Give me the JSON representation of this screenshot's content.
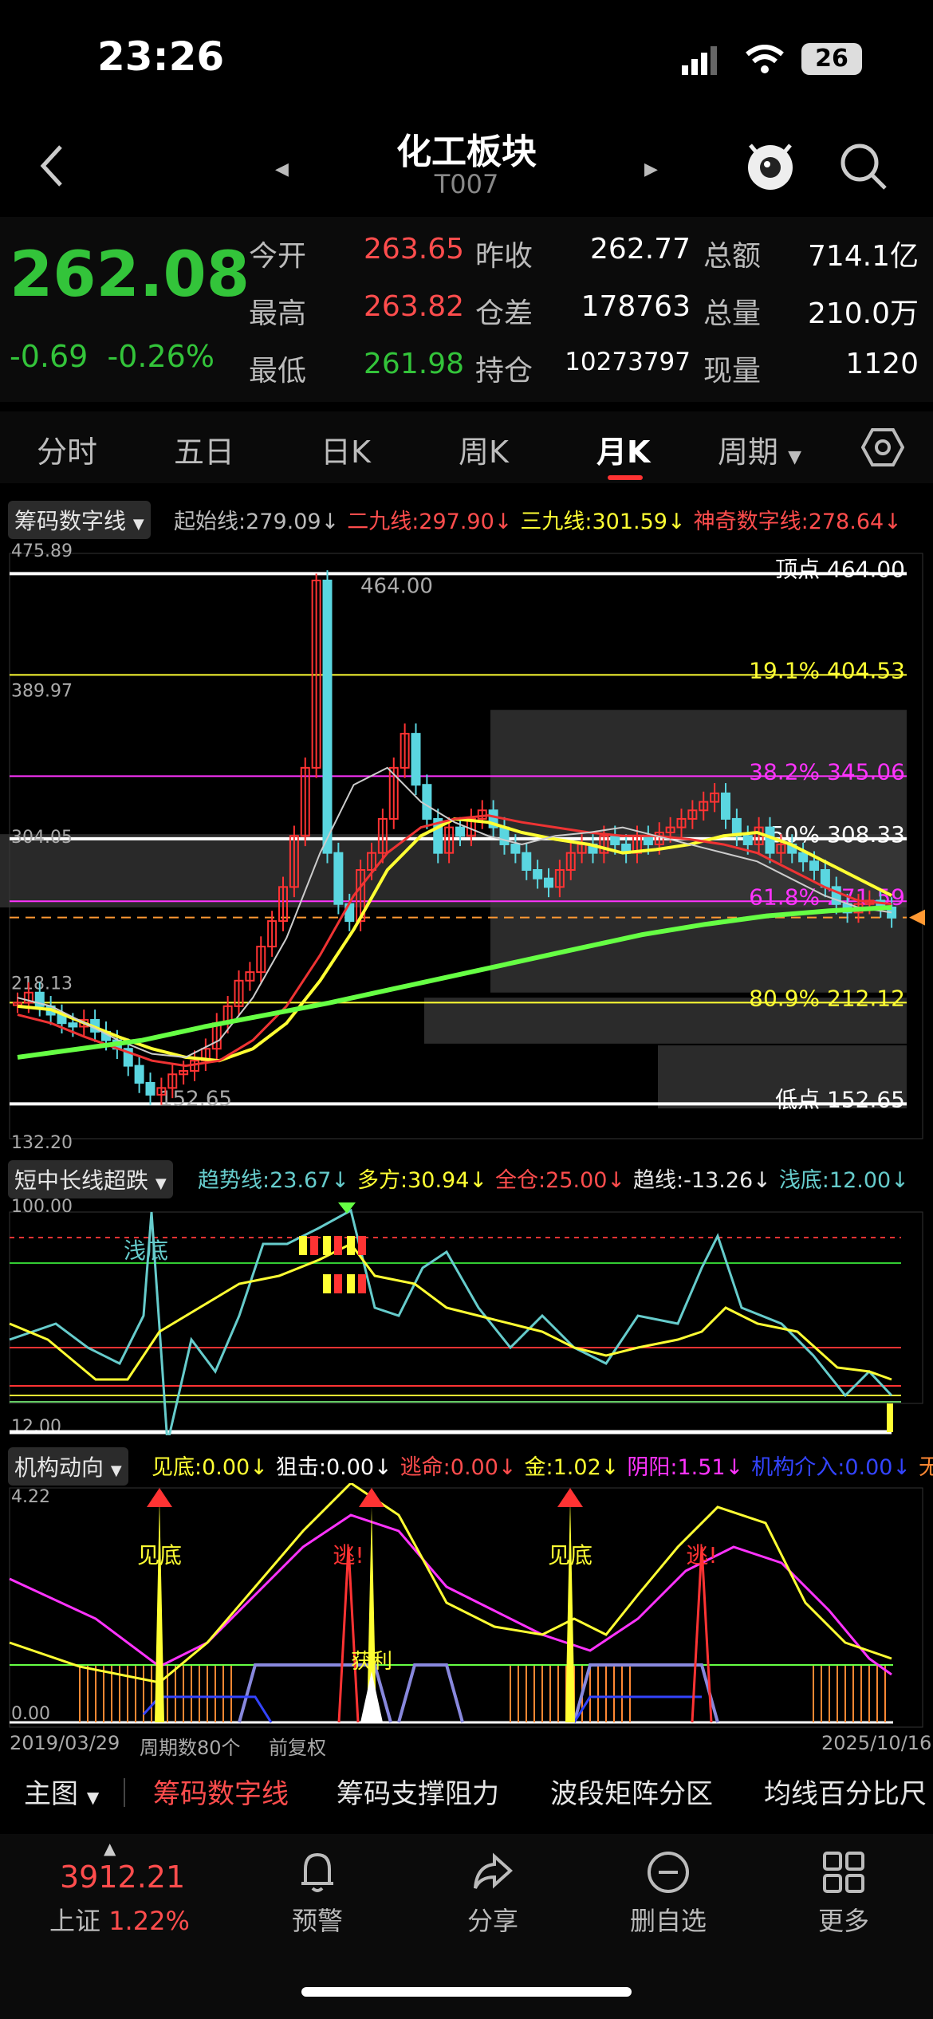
{
  "status": {
    "time": "23:26",
    "battery": "26"
  },
  "nav": {
    "title": "化工板块",
    "code": "T007"
  },
  "quote": {
    "price": "262.08",
    "change": "-0.69",
    "change_pct": "-0.26%",
    "rows": [
      [
        {
          "l": "今开",
          "v": "263.65",
          "c": "#ff4d4d"
        },
        {
          "l": "昨收",
          "v": "262.77",
          "c": "#fff"
        },
        {
          "l": "总额",
          "v": "714.1亿",
          "c": "#fff"
        }
      ],
      [
        {
          "l": "最高",
          "v": "263.82",
          "c": "#ff4d4d"
        },
        {
          "l": "仓差",
          "v": "178763",
          "c": "#fff"
        },
        {
          "l": "总量",
          "v": "210.0万",
          "c": "#fff"
        }
      ],
      [
        {
          "l": "最低",
          "v": "261.98",
          "c": "#33c43a"
        },
        {
          "l": "持仓",
          "v": "10273797",
          "c": "#fff"
        },
        {
          "l": "现量",
          "v": "1120",
          "c": "#fff"
        }
      ]
    ]
  },
  "tabs": [
    "分时",
    "五日",
    "日K",
    "周K",
    "月K",
    "周期"
  ],
  "main_chart": {
    "indicator": "筹码数字线",
    "legend": [
      {
        "t": "起始线:",
        "v": "279.09",
        "c": "#bbbbbb"
      },
      {
        "t": "二九线:",
        "v": "297.90",
        "c": "#ff4d4d"
      },
      {
        "t": "三九线:",
        "v": "301.59",
        "c": "#ffff33"
      },
      {
        "t": "神奇数字线:",
        "v": "278.64",
        "c": "#ff4d4d"
      }
    ],
    "ytop": "475.89",
    "ymid1": "389.97",
    "ymid2": "304.05",
    "ymid3": "218.13",
    "ybot": "132.20",
    "high_label": "464.00",
    "low_label": "152.65",
    "levels": [
      {
        "t": "顶点",
        "v": "464.00",
        "c": "#ffffff"
      },
      {
        "t": "19.1%",
        "v": "404.53",
        "c": "#ffff33"
      },
      {
        "t": "38.2%",
        "v": "345.06",
        "c": "#ff33ff"
      },
      {
        "t": "50%",
        "v": "308.33",
        "c": "#ffffff"
      },
      {
        "t": "61.8%",
        "v": "271.59",
        "c": "#ff33ff"
      },
      {
        "t": "80.9%",
        "v": "212.12",
        "c": "#ffff33"
      },
      {
        "t": "低点",
        "v": "152.65",
        "c": "#ffffff"
      }
    ]
  },
  "sub1": {
    "indicator": "短中长线超跌",
    "legend": [
      {
        "t": "趋势线:",
        "v": "23.67",
        "c": "#66cccc"
      },
      {
        "t": "多方:",
        "v": "30.94",
        "c": "#ffff33"
      },
      {
        "t": "全仓:",
        "v": "25.00",
        "c": "#ff4d4d"
      },
      {
        "t": "趋线:",
        "v": "-13.26",
        "c": "#e6e6e6"
      },
      {
        "t": "浅底:",
        "v": "12.00",
        "c": "#66cccc"
      }
    ],
    "ytop": "100.00",
    "ybot": "12.00",
    "label": "浅底"
  },
  "sub2": {
    "indicator": "机构动向",
    "legend": [
      {
        "t": "见底:",
        "v": "0.00",
        "c": "#ffff33"
      },
      {
        "t": "狙击:",
        "v": "0.00",
        "c": "#ffffff"
      },
      {
        "t": "逃命:",
        "v": "0.00",
        "c": "#ff4d4d"
      },
      {
        "t": "金:",
        "v": "1.02",
        "c": "#ffff33"
      },
      {
        "t": "阴阳:",
        "v": "1.51",
        "c": "#ff33ff"
      },
      {
        "t": "机构介入:",
        "v": "0.00",
        "c": "#3344ff"
      },
      {
        "t": "无庄",
        "v": "",
        "c": "#ff8833"
      }
    ],
    "ytop": "4.22",
    "ybot": "0.00",
    "tags": [
      "见底",
      "逃!",
      "见底",
      "逃!",
      "获利"
    ]
  },
  "axis": {
    "start": "2019/03/29",
    "count": "周期数80个",
    "adj": "前复权",
    "end": "2025/10/16"
  },
  "bottom_tabs": [
    "主图",
    "筹码数字线",
    "筹码支撑阻力",
    "波段矩阵分区",
    "均线百分比尺"
  ],
  "dock": {
    "index_value": "3912.21",
    "index_name": "上证",
    "index_pct": "1.22%",
    "items": [
      "预警",
      "分享",
      "删自选",
      "更多"
    ]
  },
  "chart_data": {
    "type": "candlestick",
    "title": "化工板块 月K",
    "ylim": [
      132.2,
      475.89
    ],
    "x_range": [
      "2019/03/29",
      "2025/10/16"
    ],
    "periods": 80,
    "high": 464.0,
    "low": 152.65,
    "last": 262.08
  }
}
